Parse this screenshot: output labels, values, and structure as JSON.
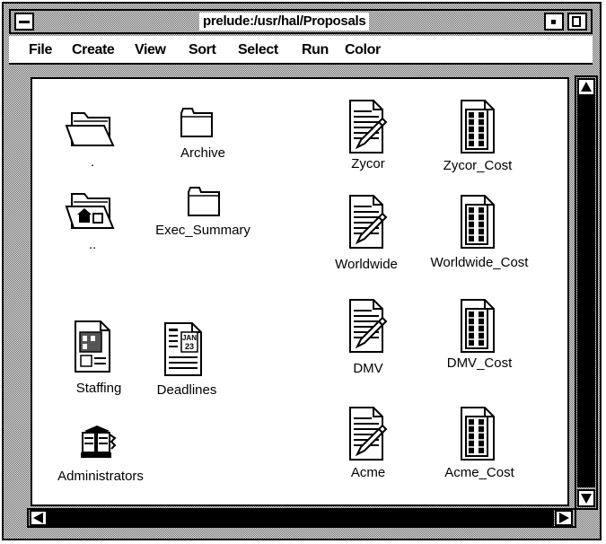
{
  "window": {
    "title": "prelude:/usr/hal/Proposals"
  },
  "menubar": {
    "items": [
      "File",
      "Create",
      "View",
      "Sort",
      "Select",
      "Run",
      "Color"
    ]
  },
  "icons": {
    "current_dir": ".",
    "parent_dir": "..",
    "archive": "Archive",
    "exec_summary": "Exec_Summary",
    "staffing": "Staffing",
    "deadlines": "Deadlines",
    "administrators": "Administrators",
    "zycor": "Zycor",
    "zycor_cost": "Zycor_Cost",
    "worldwide": "Worldwide",
    "worldwide_cost": "Worldwide_Cost",
    "dmv": "DMV",
    "dmv_cost": "DMV_Cost",
    "acme": "Acme",
    "acme_cost": "Acme_Cost",
    "calendar_month": "JAN",
    "calendar_day": "23"
  },
  "scrollbars": {
    "vertical_position": 0,
    "horizontal_position": 0
  }
}
